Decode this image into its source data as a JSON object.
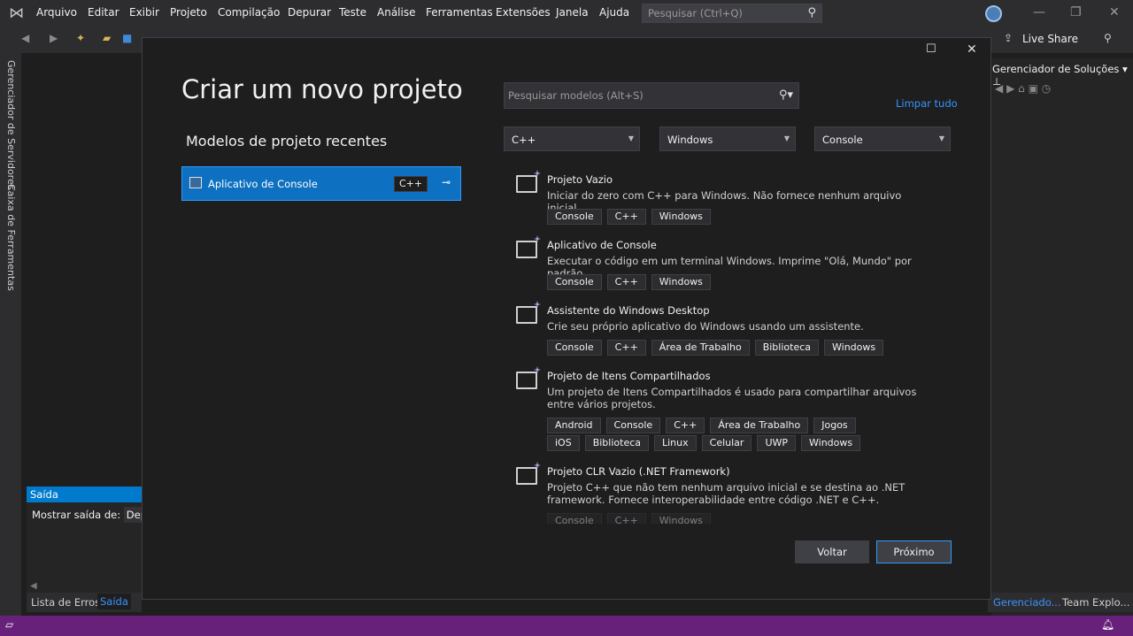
{
  "menubar": {
    "items": [
      "Arquivo",
      "Editar",
      "Exibir",
      "Projeto",
      "Compilação",
      "Depurar",
      "Teste",
      "Análise",
      "Ferramentas",
      "Extensões",
      "Janela",
      "Ajuda"
    ],
    "search_placeholder": "Pesquisar (Ctrl+Q)"
  },
  "toolbar": {
    "live_share": "Live Share"
  },
  "side_tabs": [
    "Gerenciador de Servidores",
    "Caixa de Ferramentas"
  ],
  "solution_explorer": {
    "title": "Gerenciador de Soluções",
    "tab_1": "Gerenciado...",
    "tab_2": "Team Explo..."
  },
  "output": {
    "title": "Saída",
    "show_label": "Mostrar saída de:",
    "show_value": "Depur",
    "tab_errors": "Lista de Erros",
    "tab_output": "Saída"
  },
  "dialog": {
    "title": "Criar um novo projeto",
    "recent_title": "Modelos de projeto recentes",
    "recent_items": [
      {
        "label": "Aplicativo de Console",
        "tag": "C++"
      }
    ],
    "search_placeholder": "Pesquisar modelos (Alt+S)",
    "clear_all": "Limpar tudo",
    "filters": {
      "language": "C++",
      "platform": "Windows",
      "project_type": "Console"
    },
    "templates": [
      {
        "title": "Projeto Vazio",
        "description": "Iniciar do zero com C++ para Windows. Não fornece nenhum arquivo inicial.",
        "tags": [
          "Console",
          "C++",
          "Windows"
        ]
      },
      {
        "title": "Aplicativo de Console",
        "description": "Executar o código em um terminal Windows. Imprime \"Olá, Mundo\" por padrão.",
        "tags": [
          "Console",
          "C++",
          "Windows"
        ]
      },
      {
        "title": "Assistente do Windows Desktop",
        "description": "Crie seu próprio aplicativo do Windows usando um assistente.",
        "tags": [
          "Console",
          "C++",
          "Área de Trabalho",
          "Biblioteca",
          "Windows"
        ]
      },
      {
        "title": "Projeto de Itens Compartilhados",
        "description": "Um projeto de Itens Compartilhados é usado para compartilhar arquivos entre vários projetos.",
        "tags": [
          "Android",
          "Console",
          "C++",
          "Área de Trabalho",
          "Jogos",
          "iOS",
          "Biblioteca",
          "Linux",
          "Celular",
          "UWP",
          "Windows"
        ]
      },
      {
        "title": "Projeto CLR Vazio (.NET Framework)",
        "description": "Projeto C++ que não tem nenhum arquivo inicial e se destina ao .NET framework. Fornece interoperabilidade entre código .NET e C++.",
        "tags": [
          "Console",
          "C++",
          "Windows"
        ]
      }
    ],
    "back_label": "Voltar",
    "next_label": "Próximo"
  }
}
